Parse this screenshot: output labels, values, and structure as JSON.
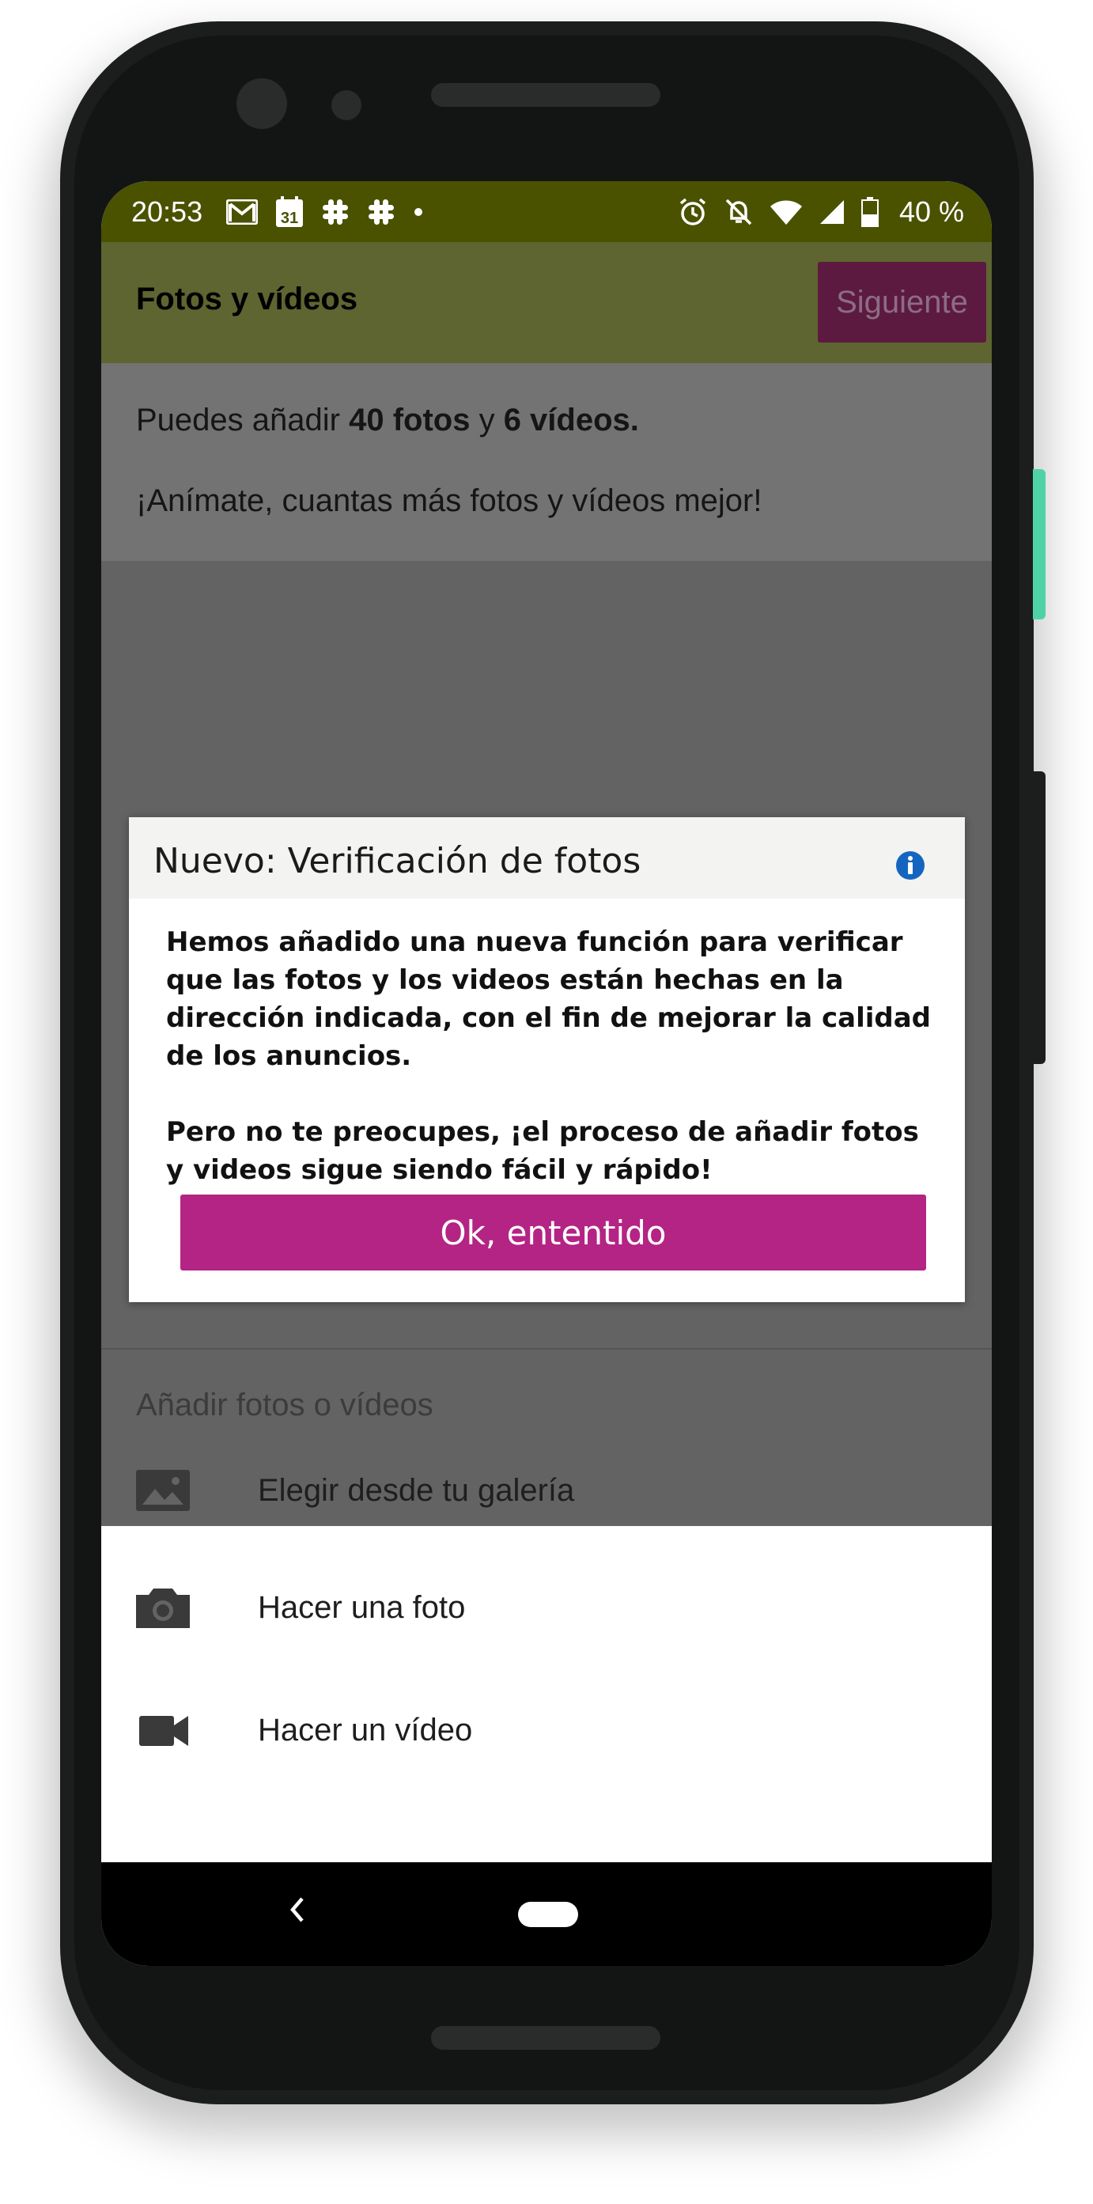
{
  "status_bar": {
    "time": "20:53",
    "battery": "40 %",
    "icons_left": [
      "gmail-icon",
      "calendar-icon",
      "slack-icon",
      "slack-icon",
      "dot-icon"
    ],
    "calendar_day": "31",
    "icons_right": [
      "alarm-icon",
      "bell-off-icon",
      "wifi-icon",
      "signal-icon",
      "battery-icon"
    ]
  },
  "app_bar": {
    "title": "Fotos y vídeos",
    "next_label": "Siguiente"
  },
  "info": {
    "line1_prefix": "Puedes añadir ",
    "photos_count": "40 fotos",
    "line1_middle": " y ",
    "videos_count": "6 vídeos.",
    "line2": "¡Anímate, cuantas más fotos y vídeos mejor!"
  },
  "add_section": {
    "title": "Añadir fotos o vídeos",
    "options": [
      {
        "label": "Elegir desde tu galería",
        "icon": "image-icon"
      },
      {
        "label": "Hacer una foto",
        "icon": "camera-icon"
      },
      {
        "label": "Hacer un vídeo",
        "icon": "video-camera-icon"
      }
    ]
  },
  "dialog": {
    "title": "Nuevo: Verificación de fotos",
    "paragraph1": "Hemos añadido una nueva función para verificar que las fotos y los videos están hechas en la dirección indicada, con el fin de mejorar la calidad de los anuncios.",
    "paragraph2": "Pero no te preocupes, ¡el proceso de añadir fotos y videos sigue siendo fácil y rápido!",
    "button_label": "Ok, ententido"
  },
  "colors": {
    "status_bar": "#4a5200",
    "app_bar": "#5e6530",
    "primary_button": "#b42484",
    "next_button": "#5d1a41",
    "info_icon": "#1565c0"
  }
}
